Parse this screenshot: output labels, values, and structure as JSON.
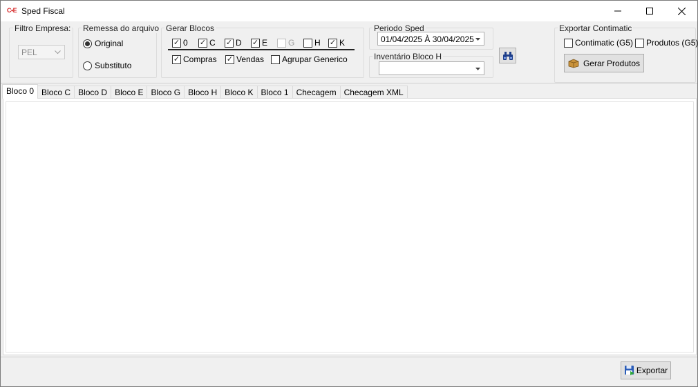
{
  "window": {
    "title": "Sped Fiscal",
    "app_icon": "C•E",
    "minimize": "—",
    "maximize": "☐",
    "close": "✕"
  },
  "filtro_empresa": {
    "legend": "Filtro Empresa:",
    "value": "PEL"
  },
  "remessa": {
    "legend": "Remessa do arquivo",
    "options": [
      {
        "label": "Original",
        "selected": true
      },
      {
        "label": "Substituto",
        "selected": false
      }
    ]
  },
  "gerar_blocos": {
    "legend": "Gerar Blocos",
    "blocks": [
      {
        "label": "0",
        "checked": true,
        "enabled": true
      },
      {
        "label": "C",
        "checked": true,
        "enabled": true
      },
      {
        "label": "D",
        "checked": true,
        "enabled": true
      },
      {
        "label": "E",
        "checked": true,
        "enabled": true
      },
      {
        "label": "G",
        "checked": false,
        "enabled": false
      },
      {
        "label": "H",
        "checked": false,
        "enabled": true
      },
      {
        "label": "K",
        "checked": true,
        "enabled": true
      }
    ],
    "options": [
      {
        "label": "Compras",
        "checked": true
      },
      {
        "label": "Vendas",
        "checked": true
      },
      {
        "label": "Agrupar Generico",
        "checked": false
      }
    ]
  },
  "periodo": {
    "legend": "Periodo Sped",
    "value": "01/04/2025 À 30/04/2025"
  },
  "inventario": {
    "legend": "Inventário Bloco H",
    "value": ""
  },
  "search_button_icon": "binoculars-icon",
  "exportar_contimatic": {
    "legend": "Exportar Contimatic",
    "options": [
      {
        "label": "Contimatic (G5)",
        "checked": false
      },
      {
        "label": "Produtos (G5)",
        "checked": false
      }
    ],
    "gerar_label": "Gerar Produtos"
  },
  "tabs": [
    {
      "label": "Bloco 0",
      "active": true
    },
    {
      "label": "Bloco C",
      "active": false
    },
    {
      "label": "Bloco D",
      "active": false
    },
    {
      "label": "Bloco E",
      "active": false
    },
    {
      "label": "Bloco G",
      "active": false
    },
    {
      "label": "Bloco H",
      "active": false
    },
    {
      "label": "Bloco K",
      "active": false
    },
    {
      "label": "Bloco 1",
      "active": false
    },
    {
      "label": "Checagem",
      "active": false
    },
    {
      "label": "Checagem XML",
      "active": false
    }
  ],
  "footer": {
    "export_label": "Exportar"
  },
  "colors": {
    "window_bg": "#f0f0f0",
    "accent_red": "#d42020",
    "button_bg": "#e1e1e1"
  }
}
